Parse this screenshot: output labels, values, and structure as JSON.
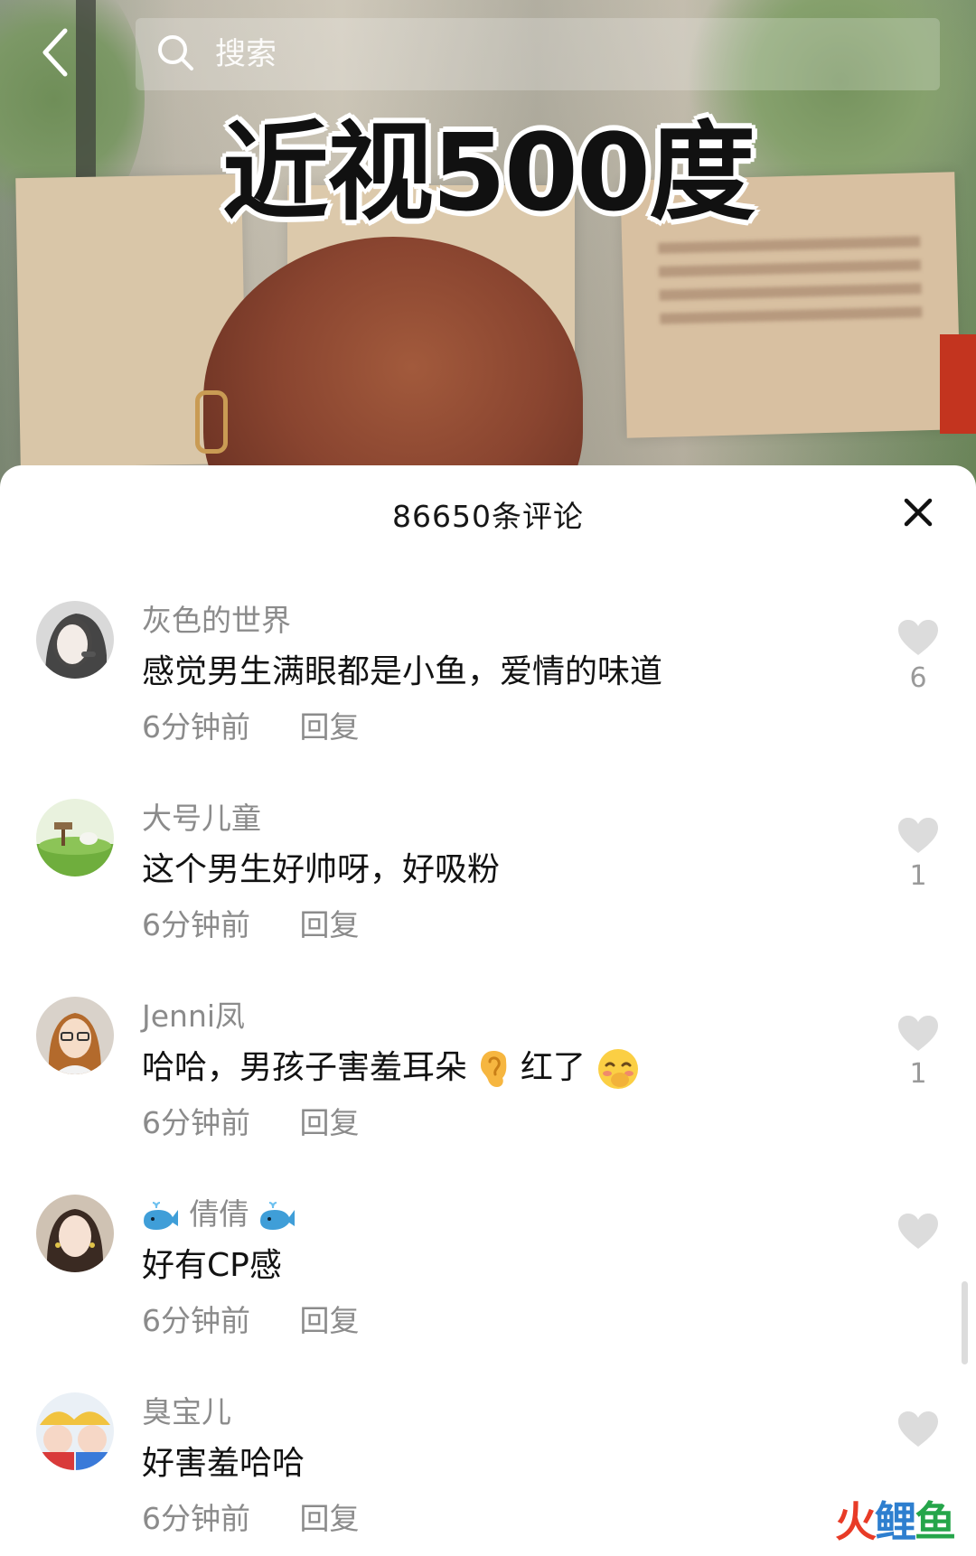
{
  "video": {
    "overlay_title": "近视500度"
  },
  "topbar": {
    "search_placeholder": "搜索"
  },
  "sheet": {
    "comment_count_label": "86650条评论",
    "close_icon": "close-icon"
  },
  "comments": [
    {
      "username": "灰色的世界",
      "text": "感觉男生满眼都是小鱼，爱情的味道",
      "time": "6分钟前",
      "reply_label": "回复",
      "likes": "6"
    },
    {
      "username": "大号儿童",
      "text": "这个男生好帅呀，好吸粉",
      "time": "6分钟前",
      "reply_label": "回复",
      "likes": "1"
    },
    {
      "username": "Jenni凤",
      "text_a": "哈哈，男孩子害羞耳朵",
      "text_b": "红了",
      "emoji_a": "ear-emoji",
      "emoji_b": "blushing-face-emoji",
      "time": "6分钟前",
      "reply_label": "回复",
      "likes": "1"
    },
    {
      "username": "倩倩",
      "username_emoji": "whale-emoji",
      "text": "好有CP感",
      "time": "6分钟前",
      "reply_label": "回复",
      "likes": ""
    },
    {
      "username": "臭宝儿",
      "text": "好害羞哈哈",
      "time": "6分钟前",
      "reply_label": "回复",
      "likes": ""
    }
  ],
  "watermark": {
    "part_a": "火",
    "part_b": "鲤",
    "part_c": "鱼"
  },
  "colors": {
    "text_primary": "#121212",
    "text_secondary": "#8b8b8b",
    "like_icon": "#dcdcdc"
  }
}
